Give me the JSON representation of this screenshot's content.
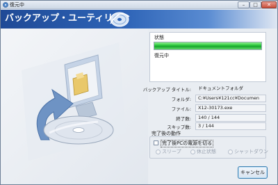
{
  "window": {
    "title": "復元中",
    "controls": {
      "minimize": "–",
      "maximize": "□",
      "close": "✕"
    }
  },
  "header": {
    "title": "バックアップ・ユーティリティ",
    "brand_colors": [
      "#1f4a96",
      "#2e64b7",
      "#5a8cd2"
    ]
  },
  "status": {
    "label": "状態",
    "progress": 1.0,
    "progress_color": "#27c43a",
    "text": "復元中"
  },
  "info": [
    {
      "label": "バックアップ タイトル:",
      "value": "ドキュメントフォルダ"
    },
    {
      "label": "フォルダ:",
      "value": "C:¥Users¥121cc¥Documen"
    },
    {
      "label": "ファイル:",
      "value": "X12-30173.exe"
    },
    {
      "label": "終了数:",
      "value": "140 / 144"
    },
    {
      "label": "スキップ数:",
      "value": "3 / 144"
    }
  ],
  "after_completion": {
    "title": "完了後の動作",
    "checkbox_label": "完了後PCの電源を切る",
    "checkbox_checked": false,
    "options": [
      "スリープ",
      "休止状態",
      "シャットダウン"
    ]
  },
  "buttons": {
    "cancel": "キャンセル"
  }
}
